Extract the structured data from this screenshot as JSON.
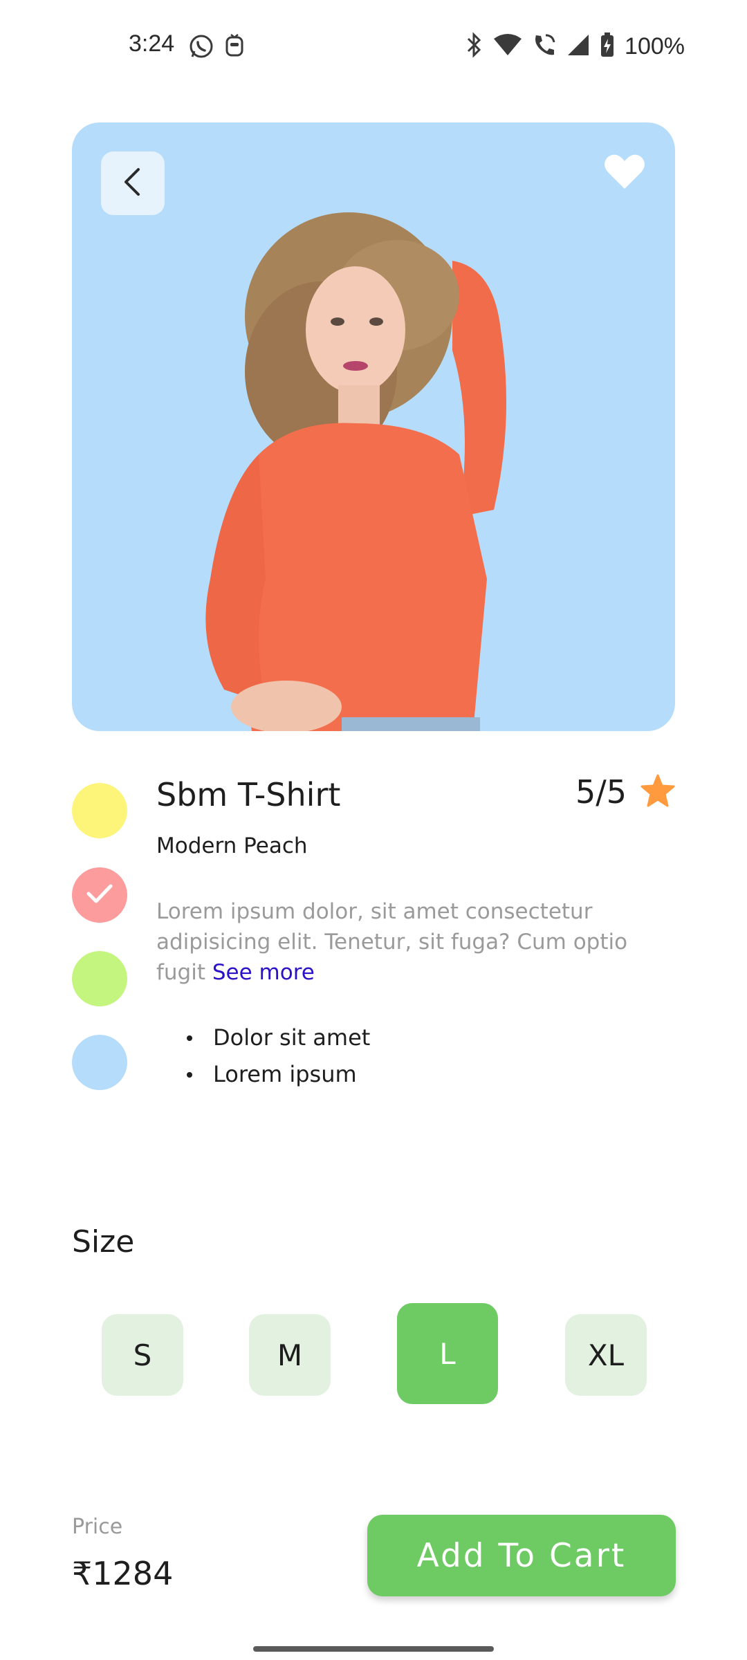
{
  "status_bar": {
    "time": "3:24",
    "battery": "100%",
    "left_icons": [
      "whatsapp-icon",
      "assistant-icon"
    ],
    "right_icons": [
      "bluetooth-icon",
      "wifi-icon",
      "wifi-calling-icon",
      "signal-icon",
      "battery-icon"
    ]
  },
  "hero": {
    "background": "#b5ddfb",
    "back_icon": "chevron-left-icon",
    "favorite_icon": "heart-icon"
  },
  "colors": {
    "swatches": [
      {
        "name": "yellow",
        "hex": "#fdf47a",
        "selected": false
      },
      {
        "name": "peach",
        "hex": "#fc9c9c",
        "selected": true
      },
      {
        "name": "lime",
        "hex": "#c4f57f",
        "selected": false
      },
      {
        "name": "blue",
        "hex": "#b5ddfb",
        "selected": false
      }
    ],
    "accent_green": "#6ecb63",
    "star": "#ff9a3e",
    "link": "#2a12c8"
  },
  "product": {
    "name": "Sbm T-Shirt",
    "subtitle": "Modern Peach",
    "rating": "5/5",
    "description": "Lorem ipsum dolor, sit amet consectetur adipisicing elit. Tenetur, sit fuga? Cum optio fugit",
    "see_more": "See more",
    "bullets": [
      "Dolor sit amet",
      "Lorem ipsum"
    ]
  },
  "size": {
    "title": "Size",
    "options": [
      "S",
      "M",
      "L",
      "XL"
    ],
    "selected": "L"
  },
  "footer": {
    "price_label": "Price",
    "price": "₹1284",
    "cart_button": "Add To Cart"
  }
}
